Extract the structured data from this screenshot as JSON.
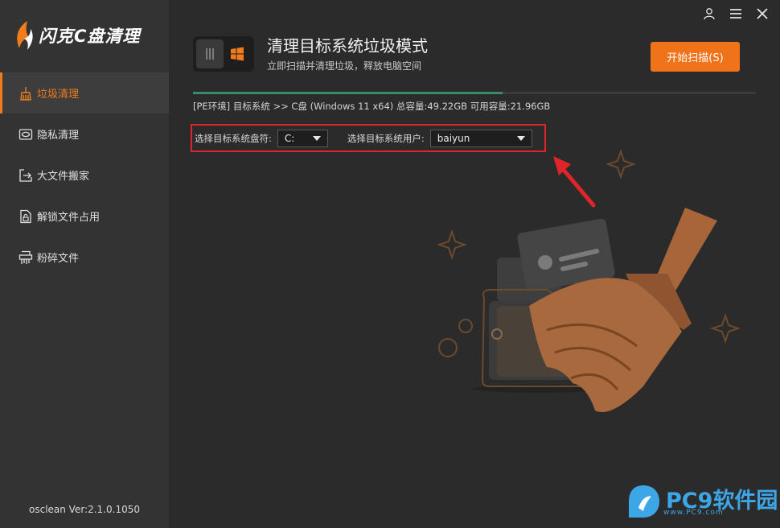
{
  "app": {
    "title": "闪克C盘清理",
    "version": "osclean Ver:2.1.0.1050"
  },
  "sidebar": {
    "items": [
      {
        "label": "垃圾清理",
        "icon": "broom-icon",
        "active": true
      },
      {
        "label": "隐私清理",
        "icon": "privacy-icon",
        "active": false
      },
      {
        "label": "大文件搬家",
        "icon": "export-icon",
        "active": false
      },
      {
        "label": "解锁文件占用",
        "icon": "unlock-file-icon",
        "active": false
      },
      {
        "label": "粉碎文件",
        "icon": "shredder-icon",
        "active": false
      }
    ]
  },
  "window_controls": [
    "user-icon",
    "menu-icon",
    "close-icon"
  ],
  "header": {
    "title": "清理目标系统垃圾模式",
    "subtitle": "立即扫描并清理垃圾，释放电脑空间",
    "scan_button": "开始扫描(S)"
  },
  "sysinfo": "[PE环境] 目标系统 >> C盘 (Windows 11 x64) 总容量:49.22GB 可用容量:21.96GB",
  "progress": {
    "fraction": 0.55
  },
  "selectors": {
    "drive_label": "选择目标系统盘符:",
    "drive_value": "C:",
    "user_label": "选择目标系统用户:",
    "user_value": "baiyun"
  },
  "watermark": {
    "brand": "PC9软件园",
    "url": "www.PC9.com"
  },
  "colors": {
    "accent": "#f07c1c",
    "highlight": "#e0252a",
    "progress": "#3c8c6c"
  }
}
